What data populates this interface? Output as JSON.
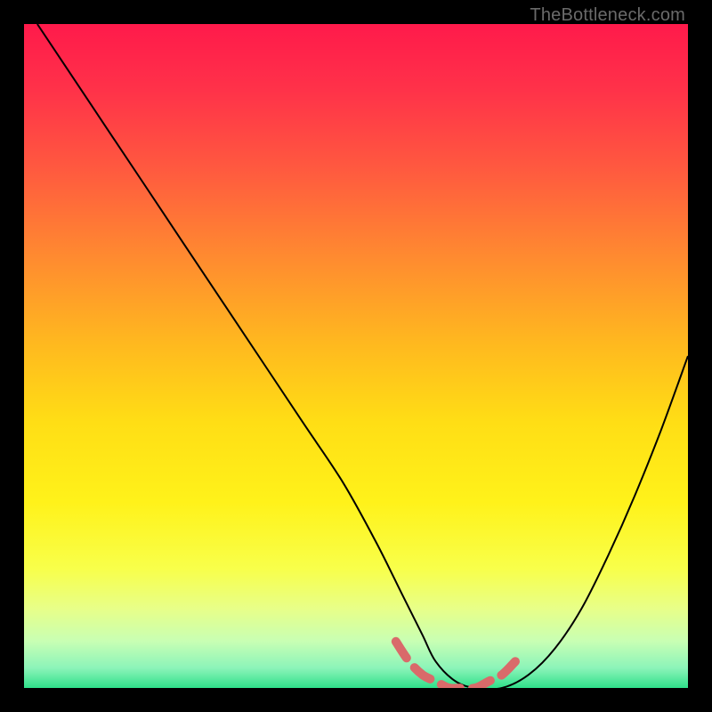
{
  "watermark": "TheBottleneck.com",
  "chart_data": {
    "type": "line",
    "title": "",
    "xlabel": "",
    "ylabel": "",
    "xlim": [
      0,
      100
    ],
    "ylim": [
      0,
      100
    ],
    "grid": false,
    "legend": false,
    "gradient_stops": [
      {
        "offset": 0.0,
        "color": "#ff1a4b"
      },
      {
        "offset": 0.1,
        "color": "#ff3249"
      },
      {
        "offset": 0.22,
        "color": "#ff5a3f"
      },
      {
        "offset": 0.35,
        "color": "#ff8a30"
      },
      {
        "offset": 0.48,
        "color": "#ffb81f"
      },
      {
        "offset": 0.6,
        "color": "#ffde15"
      },
      {
        "offset": 0.72,
        "color": "#fff21a"
      },
      {
        "offset": 0.82,
        "color": "#f8ff4a"
      },
      {
        "offset": 0.88,
        "color": "#e8ff88"
      },
      {
        "offset": 0.93,
        "color": "#c8ffb4"
      },
      {
        "offset": 0.97,
        "color": "#8cf4b9"
      },
      {
        "offset": 1.0,
        "color": "#2fe08a"
      }
    ],
    "series": [
      {
        "name": "bottleneck-curve",
        "color": "#000000",
        "x": [
          2,
          6,
          12,
          18,
          24,
          30,
          36,
          42,
          48,
          53,
          57,
          60,
          62,
          65,
          68,
          72,
          76,
          80,
          84,
          88,
          92,
          96,
          100
        ],
        "y": [
          100,
          94,
          85,
          76,
          67,
          58,
          49,
          40,
          31,
          22,
          14,
          8,
          4,
          1,
          0,
          0,
          2,
          6,
          12,
          20,
          29,
          39,
          50
        ]
      }
    ],
    "annotations": [
      {
        "name": "minimum-band",
        "color": "#d96a6a",
        "x": [
          56,
          58,
          60,
          62,
          64,
          66,
          68,
          70,
          72,
          74
        ],
        "y": [
          7,
          4,
          2,
          1,
          0,
          0,
          0,
          1,
          2,
          4
        ]
      }
    ]
  }
}
